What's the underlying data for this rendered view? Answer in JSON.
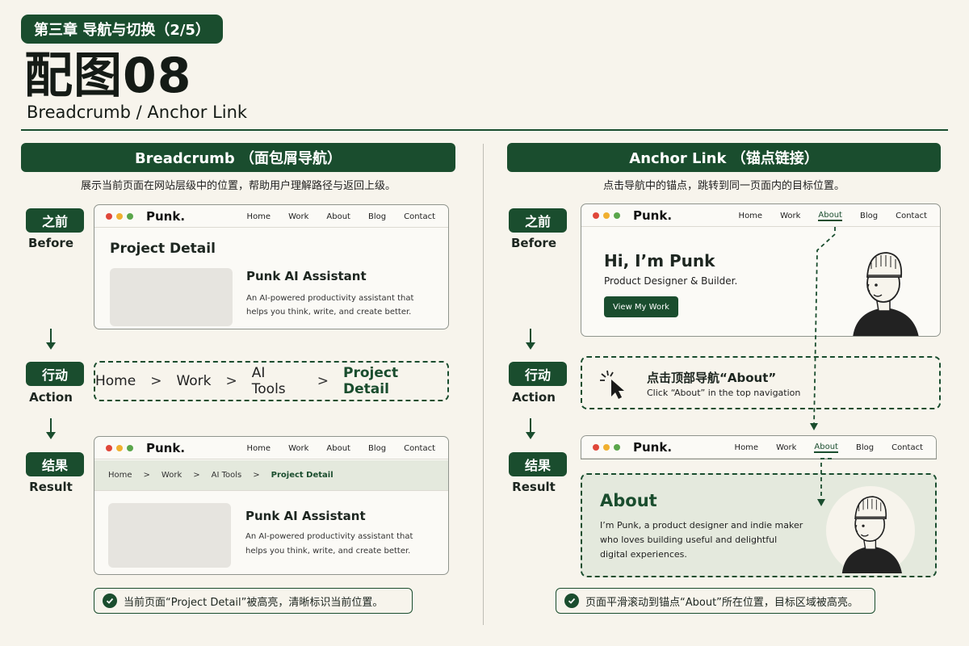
{
  "header": {
    "chapter": "第三章  导航与切换（2/5）",
    "title": "配图08",
    "subtitle": "Breadcrumb / Anchor Link"
  },
  "steps": {
    "before_cn": "之前",
    "before_en": "Before",
    "action_cn": "行动",
    "action_en": "Action",
    "result_cn": "结果",
    "result_en": "Result"
  },
  "site": {
    "logo": "Punk.",
    "nav": [
      "Home",
      "Work",
      "About",
      "Blog",
      "Contact"
    ]
  },
  "left": {
    "heading": "Breadcrumb （面包屑导航）",
    "desc": "展示当前页面在网站层级中的位置，帮助用户理解路径与返回上级。",
    "page_title": "Project Detail",
    "card_title": "Punk AI Assistant",
    "card_desc_1": "An AI-powered productivity assistant that",
    "card_desc_2": "helps you think, write, and create better.",
    "crumbs": [
      "Home",
      "Work",
      "AI Tools",
      "Project Detail"
    ],
    "sep": ">",
    "note": "当前页面“Project Detail”被高亮，清晰标识当前位置。"
  },
  "right": {
    "heading": "Anchor Link （锚点链接）",
    "desc": "点击导航中的锚点，跳转到同一页面内的目标位置。",
    "hero_title": "Hi, I’m Punk",
    "hero_sub": "Product Designer & Builder.",
    "hero_btn": "View My Work",
    "action_cn": "点击顶部导航“About”",
    "action_en": "Click “About” in the top navigation",
    "about_title": "About",
    "about_1": "I’m Punk, a product designer and indie maker",
    "about_2": "who loves building useful and delightful",
    "about_3": "digital experiences.",
    "note": "页面平滑滚动到锚点“About”所在位置，目标区域被高亮。"
  },
  "colors": {
    "accent": "#1a4d2e",
    "background": "#f7f4ec",
    "dot_red": "#e0473a",
    "dot_yellow": "#f0b030",
    "dot_green": "#5aa64b"
  },
  "icons": [
    "cursor-click-icon",
    "check-icon",
    "avatar-illustration"
  ]
}
